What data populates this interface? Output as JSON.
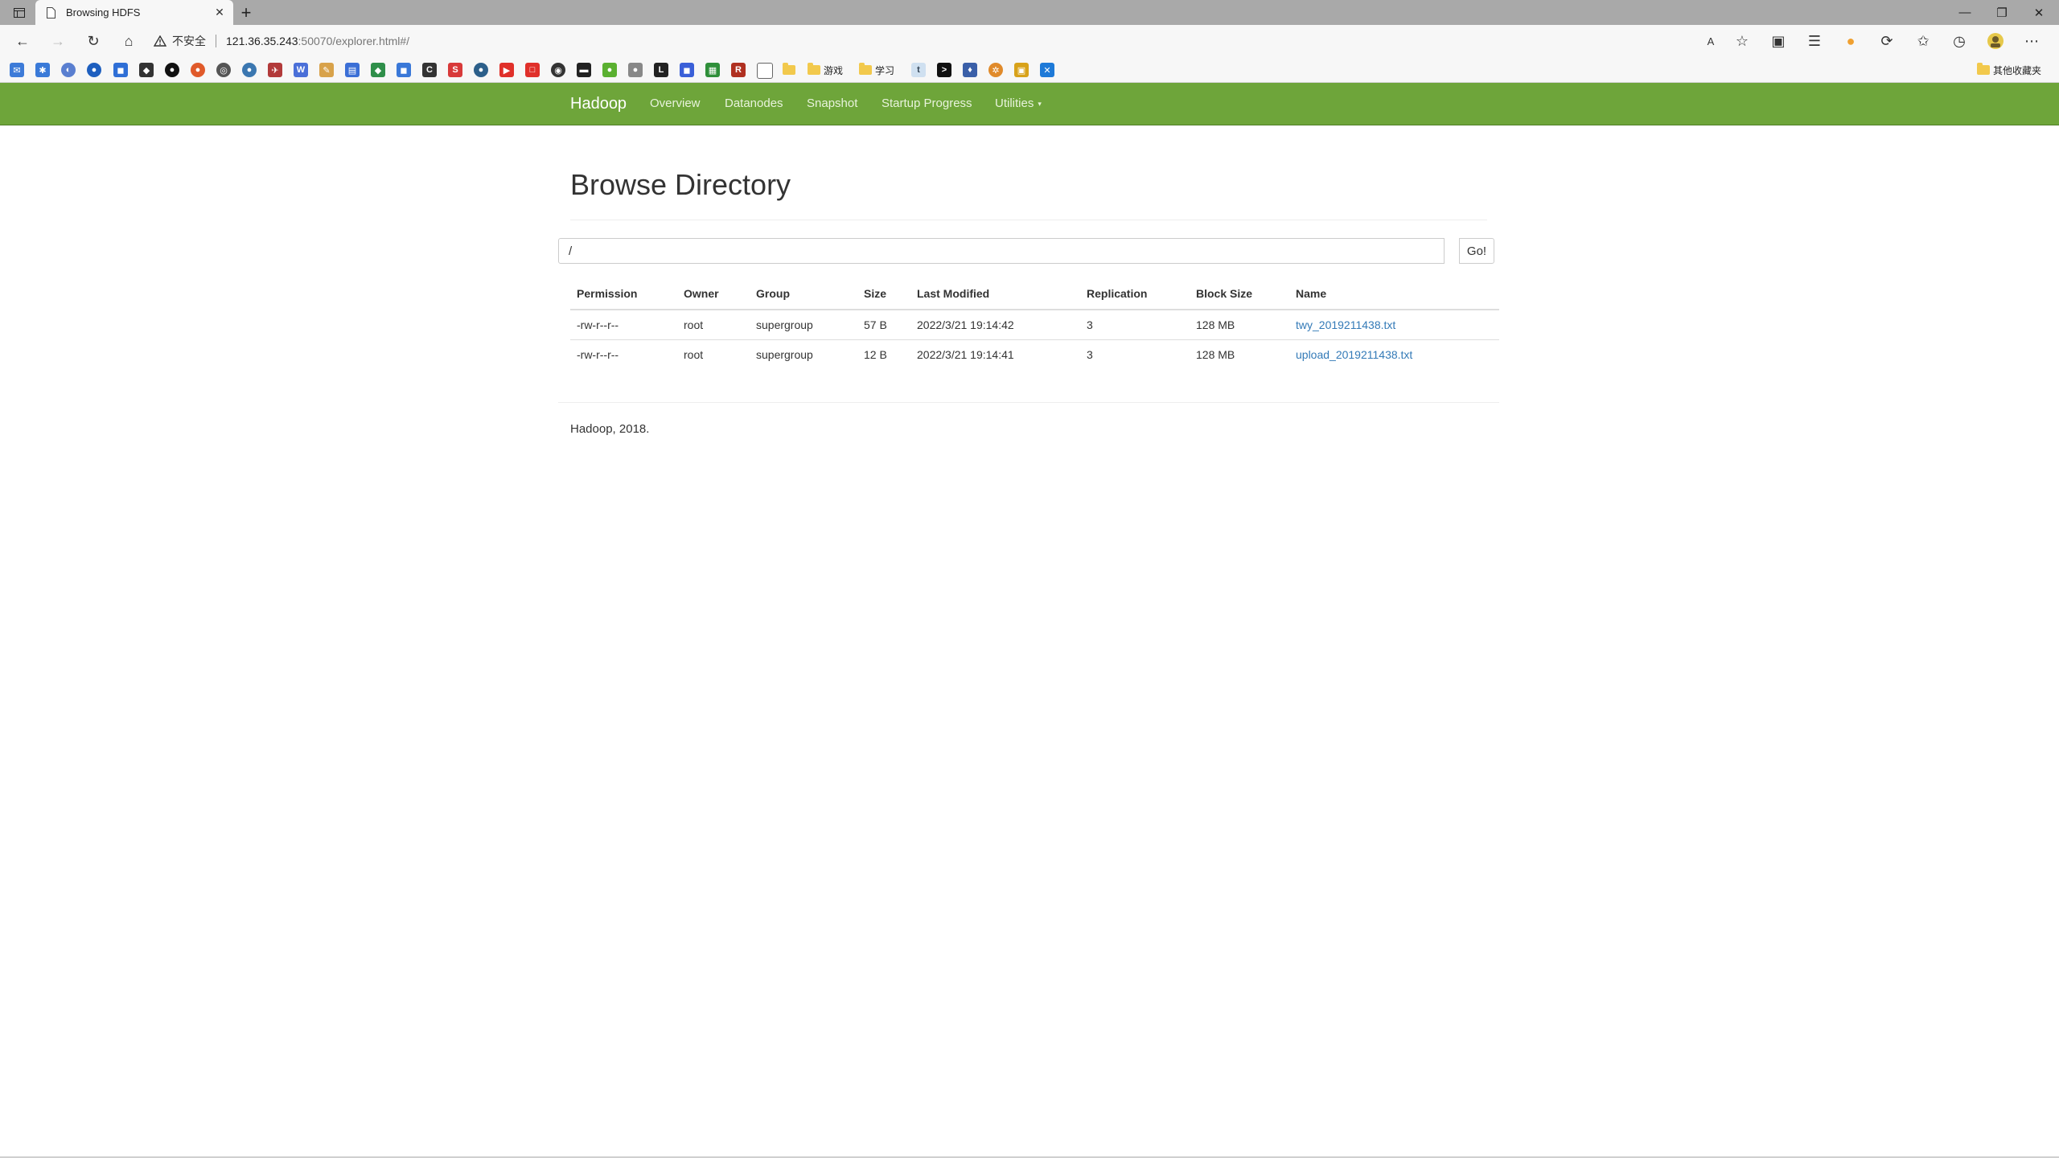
{
  "browser": {
    "tab_title": "Browsing HDFS",
    "address": {
      "security_label": "不安全",
      "host": "121.36.35.243",
      "rest": ":50070/explorer.html#/"
    },
    "bookmark_folders": [
      "游戏",
      "学习"
    ],
    "other_bookmarks_label": "其他收藏夹"
  },
  "navbar": {
    "brand": "Hadoop",
    "links": [
      "Overview",
      "Datanodes",
      "Snapshot",
      "Startup Progress",
      "Utilities"
    ]
  },
  "main": {
    "title": "Browse Directory",
    "path_value": "/",
    "go_label": "Go!",
    "table": {
      "headers": [
        "Permission",
        "Owner",
        "Group",
        "Size",
        "Last Modified",
        "Replication",
        "Block Size",
        "Name"
      ],
      "rows": [
        [
          "-rw-r--r--",
          "root",
          "supergroup",
          "57 B",
          "2022/3/21 19:14:42",
          "3",
          "128 MB",
          "twy_2019211438.txt"
        ],
        [
          "-rw-r--r--",
          "root",
          "supergroup",
          "12 B",
          "2022/3/21 19:14:41",
          "3",
          "128 MB",
          "upload_2019211438.txt"
        ]
      ]
    },
    "footer": "Hadoop, 2018."
  },
  "colors": {
    "navbar": "#6ea53a",
    "link": "#337ab7",
    "tabstrip": "#a9a9a9"
  }
}
